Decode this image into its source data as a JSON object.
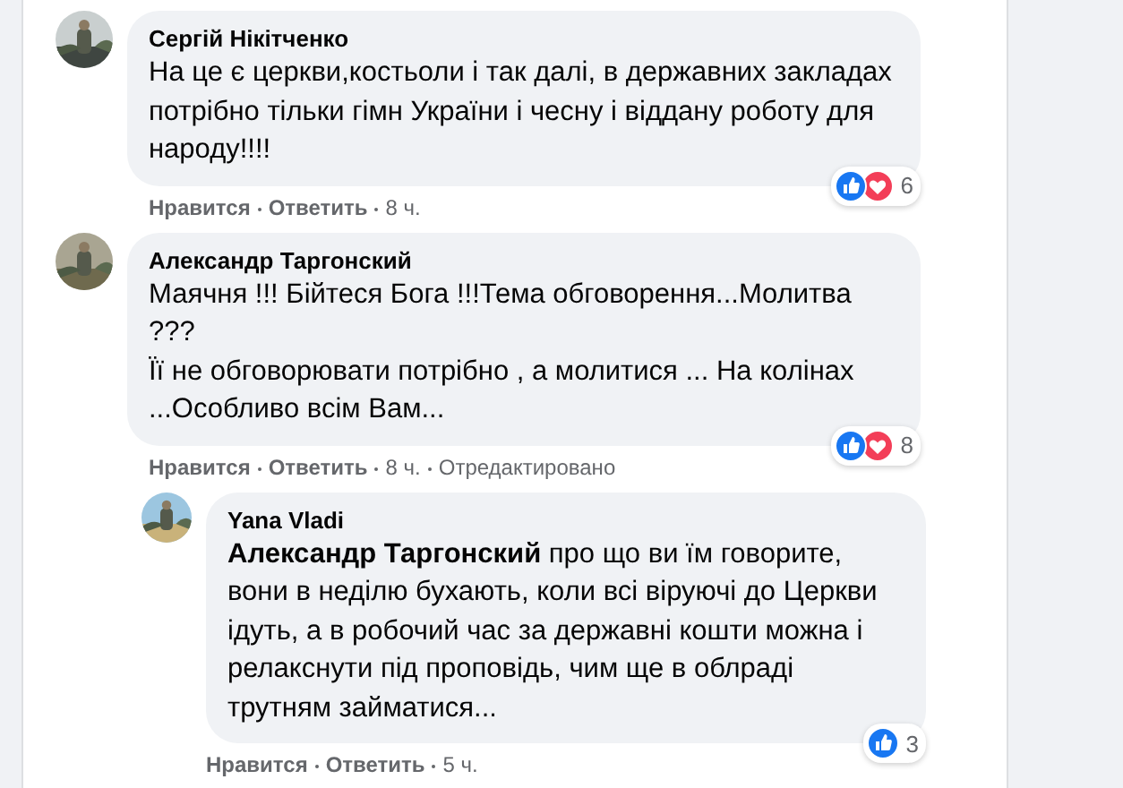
{
  "comments": [
    {
      "author": "Сергій Нікітченко",
      "text": "На це є церкви,костьоли і так далі, в державних закладах потрібно тільки гімн України і чесну і віддану роботу для народу!!!!",
      "reactions": {
        "like": true,
        "love": true,
        "count": "6"
      },
      "actions": {
        "like": "Нравится",
        "reply": "Ответить",
        "time": "8 ч."
      }
    },
    {
      "author": "Александр Таргонский",
      "text": "Маячня !!! Бійтеся Бога !!!Тема обговорення...Молитва ???\nЇї не обговорювати потрібно , а молитися ... На колінах ...Особливо всім Вам...",
      "reactions": {
        "like": true,
        "love": true,
        "count": "8"
      },
      "actions": {
        "like": "Нравится",
        "reply": "Ответить",
        "time": "8 ч.",
        "edited": "Отредактировано"
      },
      "replies": [
        {
          "author": "Yana Vladi",
          "text": "**Александр Таргонский** про що ви їм говорите, вони в неділю бухають, коли всі віруючі до Церкви ідуть, а в робочий час за державні кошти можна і релакснути під проповідь, чим ще в облраді трутням займатися...",
          "reactions": {
            "like": true,
            "love": false,
            "count": "3"
          },
          "actions": {
            "like": "Нравится",
            "reply": "Ответить",
            "time": "5 ч."
          }
        }
      ]
    }
  ]
}
